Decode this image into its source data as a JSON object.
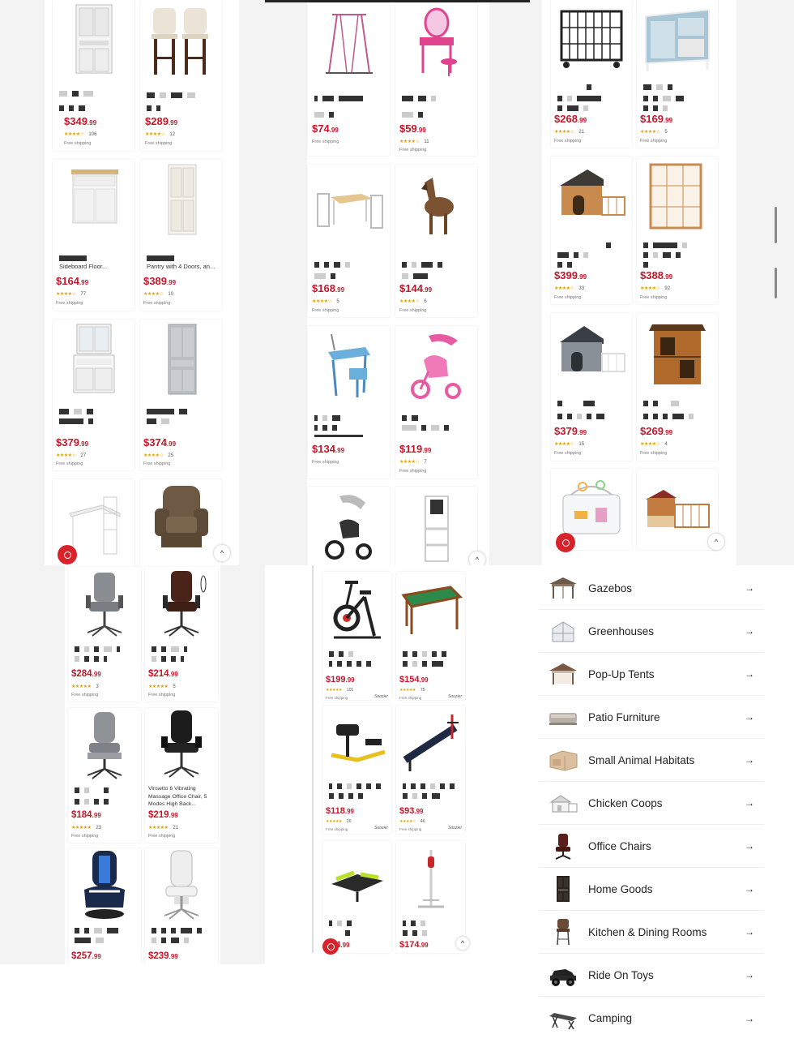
{
  "panel1": {
    "products": [
      {
        "price_main": "$349",
        "price_cents": ".99",
        "stars": "★★★★☆",
        "reviews": "106",
        "shipping": "Free shipping",
        "image": "kitchen-hutch"
      },
      {
        "price_main": "$289",
        "price_cents": ".99",
        "stars": "★★★★☆",
        "reviews": "12",
        "shipping": "Free shipping",
        "image": "bar-stools"
      },
      {
        "title": "Sideboard Floor...",
        "price_main": "$164",
        "price_cents": ".99",
        "stars": "★★★★☆",
        "reviews": "77",
        "shipping": "Free shipping",
        "image": "sideboard"
      },
      {
        "title": "Pantry with 4 Doors, an...",
        "price_main": "$389",
        "price_cents": ".99",
        "stars": "★★★★☆",
        "reviews": "10",
        "shipping": "Free shipping",
        "image": "pantry"
      },
      {
        "price_main": "$379",
        "price_cents": ".99",
        "stars": "★★★★☆",
        "reviews": "27",
        "shipping": "Free shipping",
        "image": "hutch-cabinet"
      },
      {
        "price_main": "$374",
        "price_cents": ".99",
        "stars": "★★★★☆",
        "reviews": "25",
        "shipping": "Free shipping",
        "image": "grey-cabinet"
      },
      {
        "image": "corner-desk"
      },
      {
        "image": "recliner"
      }
    ]
  },
  "panel2": {
    "products": [
      {
        "price_main": "$74",
        "price_cents": ".99",
        "shipping": "Free shipping",
        "image": "gym-bar"
      },
      {
        "price_main": "$59",
        "price_cents": ".99",
        "stars": "★★★★☆",
        "reviews": "11",
        "shipping": "Free shipping",
        "image": "vanity"
      },
      {
        "price_main": "$168",
        "price_cents": ".99",
        "stars": "★★★★☆",
        "reviews": "5",
        "shipping": "Free shipping",
        "image": "kids-table"
      },
      {
        "price_main": "$144",
        "price_cents": ".99",
        "stars": "★★★★☆",
        "reviews": "6",
        "shipping": "Free shipping",
        "image": "rocking-horse"
      },
      {
        "price_main": "$134",
        "price_cents": ".99",
        "shipping": "Free shipping",
        "image": "kids-desk"
      },
      {
        "price_main": "$119",
        "price_cents": ".99",
        "stars": "★★★★☆",
        "reviews": "7",
        "shipping": "Free shipping",
        "image": "tricycle"
      },
      {
        "image": "stroller-trike"
      },
      {
        "image": "learning-tower"
      }
    ]
  },
  "panel3": {
    "products": [
      {
        "price_main": "$268",
        "price_cents": ".99",
        "stars": "★★★★☆",
        "reviews": "21",
        "shipping": "Free shipping",
        "image": "dog-crate"
      },
      {
        "price_main": "$169",
        "price_cents": ".99",
        "stars": "★★★★☆",
        "reviews": "5",
        "shipping": "Free shipping",
        "image": "rabbit-hutch"
      },
      {
        "price_main": "$399",
        "price_cents": ".99",
        "stars": "★★★★☆",
        "reviews": "33",
        "shipping": "Free shipping",
        "image": "dog-house"
      },
      {
        "price_main": "$388",
        "price_cents": ".99",
        "stars": "★★★★☆",
        "reviews": "92",
        "shipping": "Free shipping",
        "image": "catio"
      },
      {
        "price_main": "$379",
        "price_cents": ".99",
        "stars": "★★★★☆",
        "reviews": "15",
        "shipping": "Free shipping",
        "image": "grey-dog-house"
      },
      {
        "price_main": "$269",
        "price_cents": ".99",
        "stars": "★★★★☆",
        "reviews": "4",
        "shipping": "Free shipping",
        "image": "cat-house"
      },
      {
        "image": "hamster-cage"
      },
      {
        "image": "chicken-coop"
      }
    ]
  },
  "panel4": {
    "products": [
      {
        "price_main": "$284",
        "price_cents": ".99",
        "stars": "★★★★★",
        "reviews": "3",
        "shipping": "Free shipping",
        "image": "grey-office-chair"
      },
      {
        "price_main": "$214",
        "price_cents": ".99",
        "stars": "★★★★★",
        "reviews": "5",
        "shipping": "Free shipping",
        "image": "brown-office-chair"
      },
      {
        "price_main": "$184",
        "price_cents": ".99",
        "stars": "★★★★★",
        "reviews": "23",
        "shipping": "Free shipping",
        "image": "fabric-chair"
      },
      {
        "title": "Vinsetto 6 Vibrating Massage Office Chair, 5 Modes High Back...",
        "price_main": "$219",
        "price_cents": ".99",
        "stars": "★★★★★",
        "reviews": "21",
        "shipping": "Free shipping",
        "image": "black-office-chair"
      },
      {
        "price_main": "$257",
        "price_cents": ".99",
        "image": "gaming-chair-blue"
      },
      {
        "price_main": "$239",
        "price_cents": ".99",
        "image": "gaming-chair-white"
      }
    ]
  },
  "panel5": {
    "products": [
      {
        "price_main": "$199",
        "price_cents": ".99",
        "stars": "★★★★★",
        "reviews": "101",
        "shipping": "Free shipping",
        "brand": "Soozier",
        "image": "exercise-bike"
      },
      {
        "price_main": "$154",
        "price_cents": ".99",
        "stars": "★★★★★",
        "reviews": "75",
        "shipping": "Free shipping",
        "brand": "Soozier",
        "image": "pool-table"
      },
      {
        "price_main": "$118",
        "price_cents": ".99",
        "stars": "★★★★★",
        "reviews": "26",
        "shipping": "Free shipping",
        "brand": "Soozier",
        "image": "squat-machine"
      },
      {
        "price_main": "$93",
        "price_cents": ".99",
        "stars": "★★★★☆",
        "reviews": "46",
        "shipping": "Free shipping",
        "brand": "Soozier",
        "image": "sit-up-bench"
      },
      {
        "price_main": "$84",
        "price_cents": ".99",
        "image": "stepper"
      },
      {
        "price_main": "$174",
        "price_cents": ".99",
        "image": "boxing-stand"
      }
    ]
  },
  "categories": [
    {
      "label": "Gazebos",
      "icon": "gazebo-icon",
      "arrow": "→"
    },
    {
      "label": "Greenhouses",
      "icon": "greenhouse-icon",
      "arrow": "→"
    },
    {
      "label": "Pop-Up Tents",
      "icon": "tent-icon",
      "arrow": "→"
    },
    {
      "label": "Patio Furniture",
      "icon": "patio-furniture-icon",
      "arrow": "→"
    },
    {
      "label": "Small Animal Habitats",
      "icon": "animal-habitat-icon",
      "arrow": "→"
    },
    {
      "label": "Chicken Coops",
      "icon": "chicken-coop-icon",
      "arrow": "→"
    },
    {
      "label": "Office Chairs",
      "icon": "office-chair-icon",
      "arrow": "→"
    },
    {
      "label": "Home Goods",
      "icon": "cabinet-icon",
      "arrow": "→"
    },
    {
      "label": "Kitchen & Dining Rooms",
      "icon": "bar-stool-icon",
      "arrow": "→"
    },
    {
      "label": "Ride On Toys",
      "icon": "ride-on-toy-icon",
      "arrow": "→"
    },
    {
      "label": "Camping",
      "icon": "camping-cot-icon",
      "arrow": "→"
    }
  ],
  "ui": {
    "up_arrow": "^",
    "accent": "#c4182b",
    "chat_color": "#d8232a"
  }
}
